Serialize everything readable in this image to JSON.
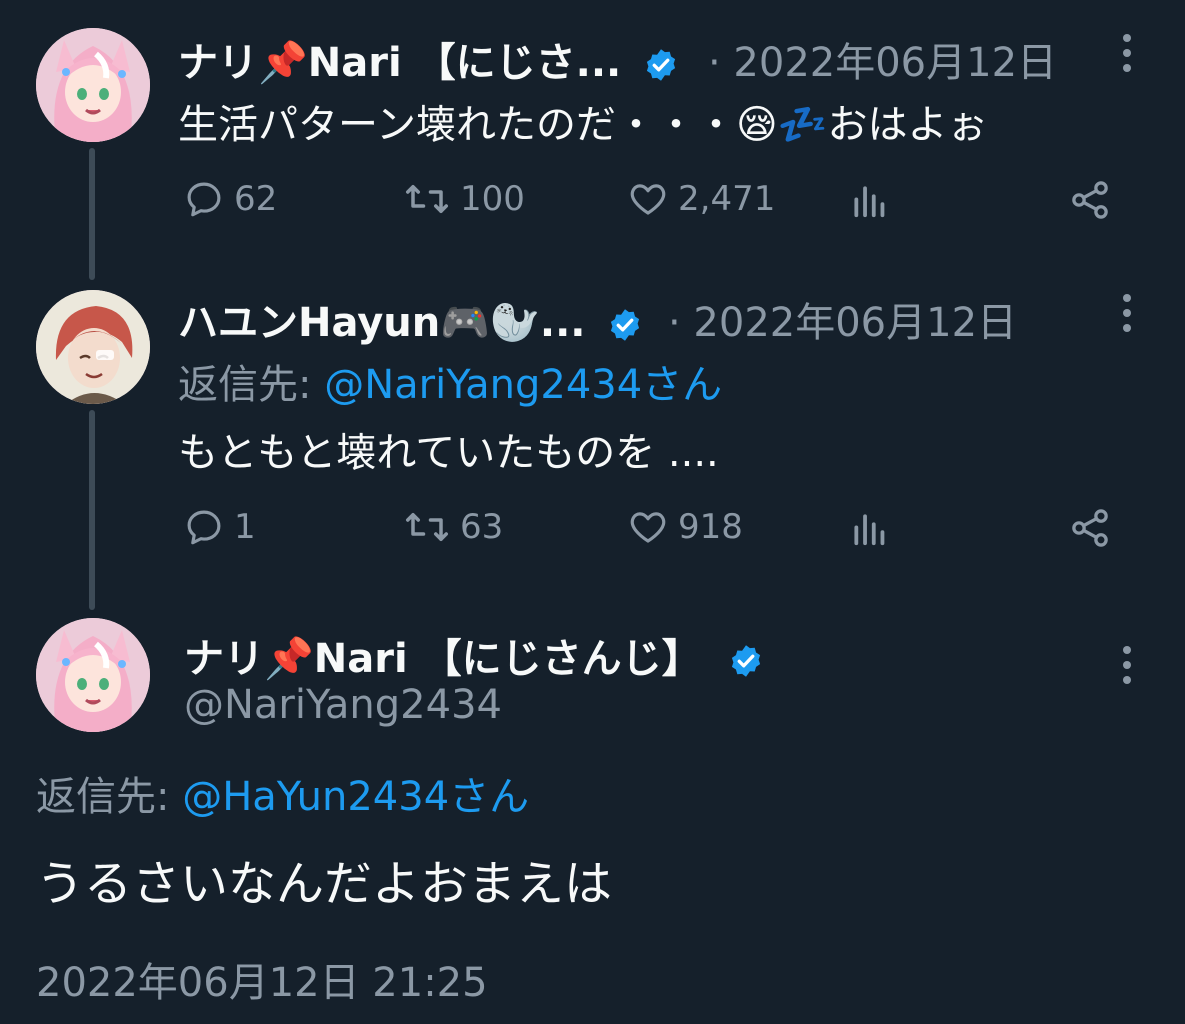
{
  "tweet1": {
    "name": "ナリ📌Nari 【にじさ...",
    "date": "· 2022年06月12日",
    "text": "生活パターン壊れたのだ・・・😪💤おはよぉ",
    "replies": "62",
    "retweets": "100",
    "likes": "2,471"
  },
  "tweet2": {
    "name": "ハユンHayun🎮🦭...",
    "date": "· 2022年06月12日",
    "reply_prefix": "返信先: ",
    "reply_to": "@NariYang2434さん",
    "text": "もともと壊れていたものを ....",
    "replies": "1",
    "retweets": "63",
    "likes": "918"
  },
  "tweet3": {
    "name": "ナリ📌Nari 【にじさんじ】",
    "handle": "@NariYang2434",
    "reply_prefix": "返信先: ",
    "reply_to": "@HaYun2434さん",
    "text": "うるさいなんだよおまえは",
    "timestamp": "2022年06月12日 21:25"
  },
  "colors": {
    "background": "#15202b",
    "text": "#f7f9f9",
    "secondary": "#8b98a5",
    "accent": "#1d9bf0",
    "thread_line": "#3d4b57"
  }
}
